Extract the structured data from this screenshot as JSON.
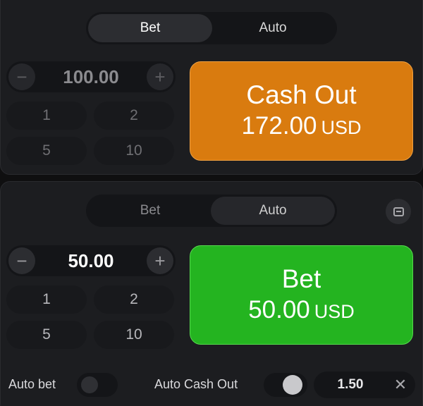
{
  "top_panel": {
    "tabs": {
      "bet": "Bet",
      "auto": "Auto"
    },
    "amount": "100.00",
    "minus": "−",
    "plus": "+",
    "quick": [
      "1",
      "2",
      "5",
      "10"
    ],
    "cashout": {
      "title": "Cash Out",
      "amount": "172.00",
      "currency": "USD"
    }
  },
  "bottom_panel": {
    "tabs": {
      "bet": "Bet",
      "auto": "Auto"
    },
    "amount": "50.00",
    "minus": "−",
    "plus": "+",
    "quick": [
      "1",
      "2",
      "5",
      "10"
    ],
    "bet": {
      "title": "Bet",
      "amount": "50.00",
      "currency": "USD"
    },
    "auto_bet_label": "Auto bet",
    "auto_cashout_label": "Auto Cash Out",
    "auto_cashout_value": "1.50",
    "clear": "✕"
  },
  "colors": {
    "cashout": "#d97b0f",
    "bet": "#24b420",
    "panel": "#1c1d20"
  },
  "state": {
    "auto_bet_enabled": false,
    "auto_cashout_enabled": false
  }
}
